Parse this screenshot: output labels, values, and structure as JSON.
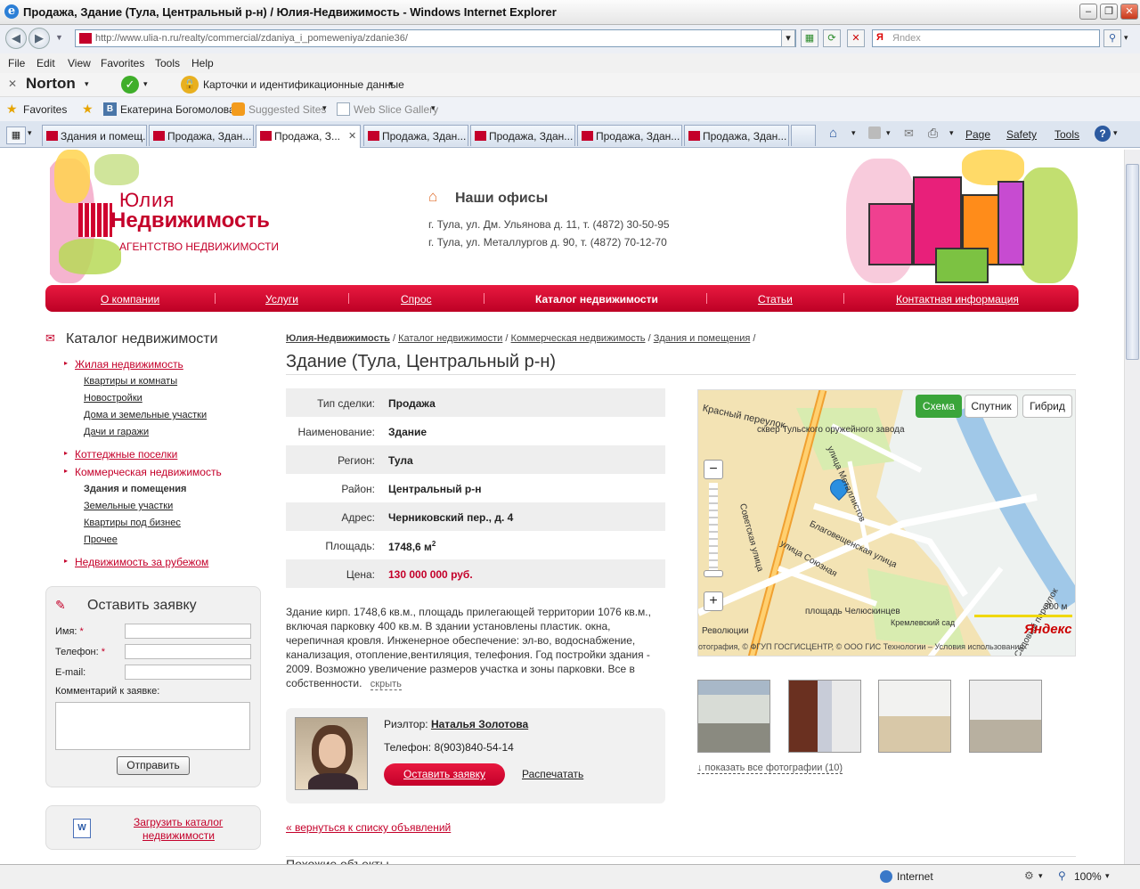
{
  "window": {
    "title": "Продажа, Здание (Тула, Центральный р-н) / Юлия-Недвижимость - Windows Internet Explorer"
  },
  "address": {
    "url": "http://www.ulia-n.ru/realty/commercial/zdaniya_i_pomeweniya/zdanie36/",
    "search_placeholder": "Яndex"
  },
  "menu": [
    "File",
    "Edit",
    "View",
    "Favorites",
    "Tools",
    "Help"
  ],
  "norton": {
    "brand": "Norton",
    "identity": "Карточки и идентификационные данные"
  },
  "favorites": {
    "label": "Favorites",
    "items": [
      "Екатерина Богомолова",
      "Suggested Sites",
      "Web Slice Gallery"
    ]
  },
  "tabs": [
    "Здания и помещ...",
    "Продажа, Здан...",
    "Продажа, З...",
    "Продажа, Здан...",
    "Продажа, Здан...",
    "Продажа, Здан...",
    "Продажа, Здан..."
  ],
  "commands": {
    "page": "Page",
    "safety": "Safety",
    "tools": "Tools"
  },
  "status": {
    "zone": "Internet",
    "zoom": "100%"
  },
  "site": {
    "logo_top": "Юлия",
    "logo_main": "Недвижимость",
    "logo_sub": "АГЕНТСТВО НЕДВИЖИМОСТИ",
    "offices_title": "Наши офисы",
    "offices": [
      "г. Тула, ул. Дм. Ульянова д. 11, т. (4872) 30-50-95",
      "г. Тула, ул. Металлургов д. 90, т. (4872) 70-12-70"
    ],
    "nav": [
      "О компании",
      "Услуги",
      "Спрос",
      "Каталог недвижимости",
      "Статьи",
      "Контактная информация"
    ]
  },
  "sidebar": {
    "title": "Каталог недвижимости",
    "residential": "Жилая недвижимость",
    "residential_sub": [
      "Квартиры и комнаты",
      "Новостройки",
      "Дома и земельные участки",
      "Дачи и гаражи"
    ],
    "cottage": "Коттеджные поселки",
    "commercial": "Коммерческая недвижимость",
    "commercial_sub": [
      "Здания и помещения",
      "Земельные участки",
      "Квартиры под бизнес",
      "Прочее"
    ],
    "abroad": "Недвижимость за рубежом"
  },
  "form": {
    "title": "Оставить заявку",
    "name": "Имя:",
    "phone": "Телефон:",
    "email": "E-mail:",
    "comment": "Комментарий к заявке:",
    "submit": "Отправить",
    "required": "*"
  },
  "download": {
    "line1": "Загрузить каталог",
    "line2": "недвижимости"
  },
  "breadcrumb": [
    "Юлия-Недвижимость",
    "Каталог недвижимости",
    "Коммерческая недвижимость",
    "Здания и помещения"
  ],
  "breadcrumb_sep": "/",
  "heading": "Здание (Тула, Центральный р-н)",
  "details": [
    {
      "label": "Тип сделки:",
      "value": "Продажа"
    },
    {
      "label": "Наименование:",
      "value": "Здание"
    },
    {
      "label": "Регион:",
      "value": "Тула"
    },
    {
      "label": "Район:",
      "value": "Центральный р-н"
    },
    {
      "label": "Адрес:",
      "value": "Черниковский пер., д. 4"
    },
    {
      "label": "Площадь:",
      "value": "1748,6 м",
      "sup": "2"
    },
    {
      "label": "Цена:",
      "value": "130 000 000 руб."
    }
  ],
  "description": [
    "Здание кирп. 1748,6 кв.м., площадь прилегающей территории 1076 кв.м.,",
    "включая парковку 400 кв.м. В здании установлены пластик. окна,",
    "черепичная кровля. Инженерное обеспечение: эл-во, водоснабжение,",
    "канализация, отопление,вентиляция, телефония. Год постройки здания -",
    "2009. Возможно увеличение размеров участка и зоны парковки. Все в",
    "собственности."
  ],
  "hide": "скрыть",
  "realtor": {
    "label": "Риэлтор:",
    "name": "Наталья Золотова",
    "phone": "Телефон: 8(903)840-54-14",
    "request": "Оставить заявку",
    "print": "Распечатать"
  },
  "back": "« вернуться к списку объявлений",
  "similar": "Похожие объекты",
  "map": {
    "scheme": "Схема",
    "satellite": "Спутник",
    "hybrid": "Гибрид",
    "scale": "300 м",
    "brand": "Яндекс",
    "labels": [
      "Красный переулок",
      "сквер Тульского оружейного завода",
      "улица Металлистов",
      "Советская улица",
      "Благовещенская улица",
      "улица Союзная",
      "площадь Челюскинцев",
      "Кремлевский сад",
      "Революции",
      "Садовый переулок"
    ],
    "copyright": "отография, © ФГУП ГОСГИСЦЕНТР, © ООО ГИС Технологии – Условия использования"
  },
  "photos_link": "↓ показать все фотографии (10)",
  "colors": {
    "accent": "#c4002a",
    "nav": "#d8002e",
    "map_bg": "#f3e3b4",
    "scheme_btn": "#3aa53a"
  }
}
